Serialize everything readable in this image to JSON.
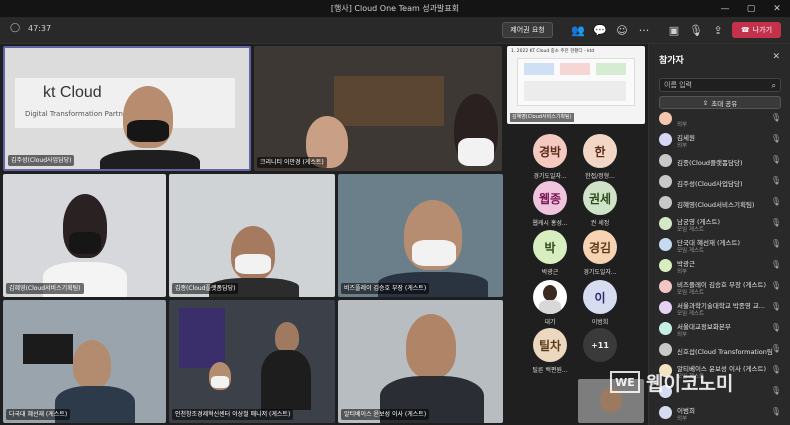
{
  "window": {
    "title": "[행사] Cloud One Team 성과발표회"
  },
  "toolbar": {
    "timer": "47:37",
    "control_request": "제어권 요청",
    "leave": "나가기"
  },
  "tiles": [
    {
      "name": "김주성(Cloud사업담당)"
    },
    {
      "name": "크리니티 이만경 (게스트)"
    },
    {
      "name": "김혜영(Cloud서비스기획팀)"
    },
    {
      "name": "김종(Cloud플랫폼담당)"
    },
    {
      "name": "비즈플레이 김승호 부장 (게스트)"
    },
    {
      "name": "다국대 혜선재 (게스트)"
    },
    {
      "name": "인천창조경제혁신센터 이상철 매니저 (게스트)"
    },
    {
      "name": "알티베이스 윤보성 이사 (게스트)"
    }
  ],
  "backdrop": {
    "logo_main": "kt Cloud",
    "logo_sub": "Digital Transformation Partner"
  },
  "shared_screen": {
    "title": "1. 2022 KT Cloud 중소 추진 현황다 - ktd",
    "presenter": "김혜영(Cloud서비스기획팀)"
  },
  "side_avatars": [
    {
      "initials": "경박",
      "label": "경기도일자...",
      "color": "#f4c9c0"
    },
    {
      "initials": "한",
      "label": "한접/정형...",
      "color": "#f2d6c6"
    },
    {
      "initials": "웹종",
      "label": "웹케시 홍성...",
      "color": "#f1c4dd"
    },
    {
      "initials": "권세",
      "label": "권 세정",
      "color": "#cfe3c9"
    },
    {
      "initials": "박",
      "label": "박광근",
      "color": "#d8edc0"
    },
    {
      "initials": "경김",
      "label": "경기도일자...",
      "color": "#f5d3b3"
    },
    {
      "initials": "",
      "label": "대기",
      "color": "#ffffff"
    },
    {
      "initials": "이",
      "label": "이범희",
      "color": "#d7dcf1"
    },
    {
      "initials": "틸차",
      "label": "틸른 백편원...",
      "color": "#ecd8be"
    },
    {
      "initials": "+11",
      "label": "",
      "color": "#3a3a3a"
    }
  ],
  "panel": {
    "title": "참가자",
    "search_placeholder": "이름 입력",
    "share_label": "초대 공유",
    "participants": [
      {
        "name": "",
        "sub": "외부",
        "color": "#f6c7b0"
      },
      {
        "name": "김세원",
        "sub": "외부",
        "color": "#d6d6f6"
      },
      {
        "name": "김종(Cloud플랫폼담당)",
        "sub": "",
        "color": "#c8c8c8"
      },
      {
        "name": "김주성(Cloud사업담당)",
        "sub": "",
        "color": "#c8c8c8"
      },
      {
        "name": "김혜영(Cloud서비스기획팀)",
        "sub": "",
        "color": "#c8c8c8"
      },
      {
        "name": "남궁영 (게스트)",
        "sub": "모임 게스트",
        "color": "#d2e8c6"
      },
      {
        "name": "단국대 혜선재 (게스트)",
        "sub": "모임 게스트",
        "color": "#c6dbef"
      },
      {
        "name": "박광근",
        "sub": "외부",
        "color": "#d8edc0"
      },
      {
        "name": "비즈플레이 김승호 부장 (게스트)",
        "sub": "모임 게스트",
        "color": "#f3c6c6"
      },
      {
        "name": "서울과학기술대학교 박종영 교...",
        "sub": "모임 게스트",
        "color": "#e6d3f3"
      },
      {
        "name": "서울대교정보화본부",
        "sub": "외부",
        "color": "#c6efe4"
      },
      {
        "name": "신호섭(Cloud Transformation팀)",
        "sub": "",
        "color": "#c8c8c8"
      },
      {
        "name": "알티베이스 윤보성 이사 (게스트)",
        "sub": "모임 게스트",
        "color": "#f3e3c0"
      },
      {
        "name": "",
        "sub": "",
        "color": "#d7dcf1"
      },
      {
        "name": "이범희",
        "sub": "외부",
        "color": "#d7dcf1"
      }
    ]
  },
  "watermark": {
    "box": "WE",
    "text": "웹이코노미"
  }
}
